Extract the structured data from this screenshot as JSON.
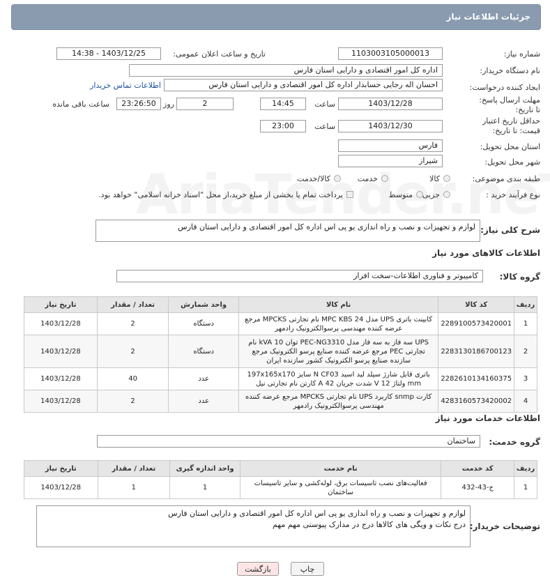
{
  "header": {
    "title": "جزئیات اطلاعات نیاز"
  },
  "watermark": "AriaTender.neT",
  "fields": {
    "need_number_label": "شماره نیاز:",
    "need_number": "1103003105000013",
    "announce_label": "تاریخ و ساعت اعلان عمومی:",
    "announce_value": "1403/12/25 - 14:38",
    "buyer_org_label": "نام دستگاه خریدار:",
    "buyer_org": "اداره کل امور اقتصادی و دارایی استان فارس",
    "creator_label": "ایجاد کننده درخواست:",
    "creator": "احسان اله  رجایی حسابدار اداره کل امور اقتصادی و دارایی استان فارس",
    "contact_link": "اطلاعات تماس خریدار",
    "deadline_label": "مهلت ارسال پاسخ: تا تاریخ:",
    "deadline_date": "1403/12/28",
    "hour_label": "ساعت",
    "deadline_time": "14:45",
    "days_value": "2",
    "days_label": "روز و",
    "remaining_time": "23:26:50",
    "remaining_label": "ساعت باقی مانده",
    "validity_label": "حداقل تاریخ اعتبار قیمت: تا تاریخ:",
    "validity_date": "1403/12/30",
    "validity_hour_label": "ساعت",
    "validity_time": "23:00",
    "province_label": "استان محل تحویل:",
    "province": "فارس",
    "city_label": "شهر محل تحویل:",
    "city": "شیراز",
    "category_label": "طبقه بندی موضوعی:",
    "category_options": [
      "کالا",
      "خدمت",
      "کالا/خدمت"
    ],
    "process_label": "نوع فرآیند خرید :",
    "process_options": [
      "جزیی",
      "متوسط"
    ],
    "payment_note": "پرداخت تمام یا بخشی از مبلغ خرید،از محل \"اسناد خزانه اسلامی\" خواهد بود.",
    "description_label": "شرح کلی نیاز:",
    "description": "لوازم و تجهیزات و نصب و راه اندازی یو پی اس اداره کل امور اقتصادی و دارایی استان فارس"
  },
  "goods": {
    "section_title": "اطلاعات کالاهای مورد نیاز",
    "group_label": "گروه کالا:",
    "group_value": "کامپیوتر و فناوری اطلاعات-سخت افزار",
    "headers": [
      "ردیف",
      "کد کالا",
      "نام کالا",
      "واحد شمارش",
      "تعداد / مقدار",
      "تاریخ نیاز"
    ],
    "rows": [
      {
        "idx": "1",
        "code": "2289100573420001",
        "name": "کابینت باتری UPS مدل MPC KBS 24 نام تجارتی MPCKS مرجع عرضه کننده مهندسی پرسوالکترونیک رادمهر",
        "unit": "دستگاه",
        "qty": "2",
        "date": "1403/12/28"
      },
      {
        "idx": "2",
        "code": "2283130186700123",
        "name": "UPS سه فاز به سه فاز مدل PEC-NG3310 توان 10 kVA نام تجارتی PEC مرجع عرضه کننده صنایع پرسو الکترونیک مرجع سازنده صنایع پرسو الکترونیک کشور سازنده ایران",
        "unit": "دستگاه",
        "qty": "2",
        "date": "1403/12/28"
      },
      {
        "idx": "3",
        "code": "2282610134160375",
        "name": "باتری قابل شارژ سیلد لید اسید N CF03 سایز 197x165x170 mm ولتاژ 12 V شدت جریان 42 A کارتن نام تجارتی نیل",
        "unit": "عدد",
        "qty": "40",
        "date": "1403/12/28"
      },
      {
        "idx": "4",
        "code": "4283160573420002",
        "name": "کارت snmp کاربرد UPS نام تجارتی MPCKS مرجع عرضه کننده مهندسی پرسوالکترونیک رادمهر",
        "unit": "عدد",
        "qty": "2",
        "date": "1403/12/28"
      }
    ]
  },
  "services": {
    "section_title": "اطلاعات خدمات مورد نیاز",
    "group_label": "گروه خدمت:",
    "group_value": "ساختمان",
    "headers": [
      "ردیف",
      "کد خدمت",
      "نام خدمت",
      "واحد اندازه گیری",
      "تعداد / مقدار",
      "تاریخ نیاز"
    ],
    "rows": [
      {
        "idx": "1",
        "code": "ج-43-432",
        "name": "فعالیت‌های نصب تاسیسات برق، لوله‌کشی و سایر تاسیسات ساختمان",
        "unit": "1",
        "qty": "1",
        "date": "1403/12/28"
      }
    ]
  },
  "buyer_notes": {
    "label": "توضیحات خریدار:",
    "line1": "لوازم و تجهیزات و نصب و راه اندازی یو پی اس اداره کل امور اقتصادی و دارایی استان فارس",
    "line2": "درج نکات و ویگی های کالاها درج در مدارک پیوستی مهم مهم"
  },
  "buttons": {
    "print": "چاپ",
    "back": "بازگشت"
  }
}
